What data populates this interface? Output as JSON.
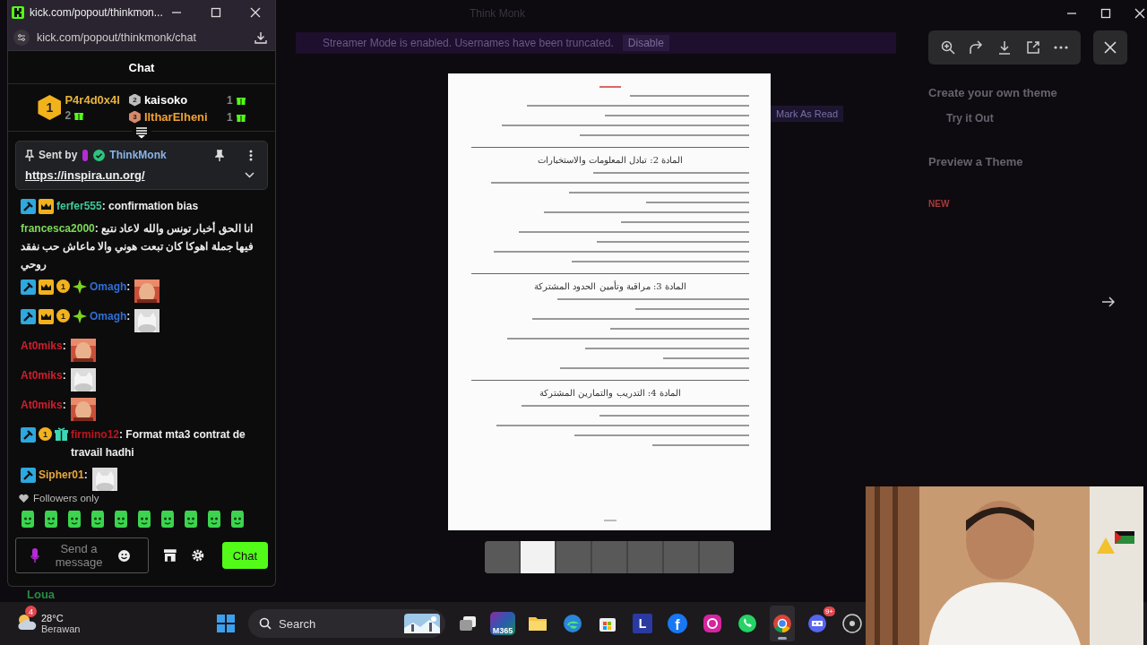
{
  "background": {
    "title": "Think Monk",
    "banner": "Streamer Mode is enabled. Usernames have been truncated.",
    "banner_button": "Disable",
    "mark_read": "Mark As Read",
    "theme_title": "Create your own theme",
    "theme_button": "Try it Out",
    "preview_title": "Preview a Theme",
    "new_badge": "NEW",
    "footer_name": "Loua"
  },
  "window": {
    "title": "kick.com/popout/thinkmon...",
    "url": "kick.com/popout/thinkmonk/chat"
  },
  "chat": {
    "heading": "Chat",
    "leaderboard": [
      {
        "rank": "1",
        "name": "P4r4d0x4l",
        "count": "2",
        "color": "#e6b43c"
      },
      {
        "rank": "2",
        "name": "kaisoko",
        "count": "1",
        "color": "#ffffff"
      },
      {
        "rank": "3",
        "name": "IltharElheni",
        "count": "1",
        "color": "#f0a232"
      }
    ],
    "pinned": {
      "label": "Sent by",
      "user": "ThinkMonk",
      "link": "https://inspira.un.org/"
    },
    "messages": [
      {
        "user": "ferfer555",
        "color": "#3fc99a",
        "badges": [
          {
            "kind": "moderator"
          },
          {
            "kind": "vip"
          }
        ],
        "separator": ":",
        "kind": "text",
        "text": "confirmation bias"
      },
      {
        "user": "francesca2000",
        "color": "#7ed957",
        "separator": ":",
        "kind": "text",
        "text": "انا الحق أخبار تونس والله لاعاد نتبع فيها جملة اهوكا كان تبعت هوني والا ماعاش حب نفقد روحي"
      },
      {
        "user": "Omagh",
        "color": "#2f6fd6",
        "badges": [
          {
            "kind": "moderator"
          },
          {
            "kind": "vip"
          },
          {
            "kind": "sub",
            "label": "1"
          },
          {
            "kind": "gem"
          }
        ],
        "separator": ":",
        "kind": "emote"
      },
      {
        "user": "Omagh",
        "color": "#2f6fd6",
        "badges": [
          {
            "kind": "moderator"
          },
          {
            "kind": "vip"
          },
          {
            "kind": "sub",
            "label": "1"
          },
          {
            "kind": "gem"
          }
        ],
        "separator": ":",
        "kind": "emote"
      },
      {
        "user": "At0miks",
        "color": "#d21e2d",
        "separator": ":",
        "kind": "emote"
      },
      {
        "user": "At0miks",
        "color": "#d21e2d",
        "separator": ":",
        "kind": "emote"
      },
      {
        "user": "At0miks",
        "color": "#d21e2d",
        "separator": ":",
        "kind": "emote"
      },
      {
        "user": "firmino12",
        "color": "#c0141e",
        "badges": [
          {
            "kind": "moderator"
          },
          {
            "kind": "sub",
            "label": "1"
          },
          {
            "kind": "gift"
          }
        ],
        "separator": ":",
        "kind": "text",
        "text": "Format mta3 contrat de travail hadhi"
      },
      {
        "user": "Sipher01",
        "color": "#e8a83c",
        "badges": [
          {
            "kind": "moderator"
          }
        ],
        "separator": ":",
        "kind": "emote"
      }
    ],
    "mode": "Followers only",
    "input": {
      "placeholder": "Send a message"
    },
    "send_button": "Chat"
  },
  "viewer": {
    "headings": [
      "المادة 2: تبادل المعلومات والاستخبارات",
      "المادة 3: مراقبة وتأمين الحدود المشتركة",
      "المادة 4: التدريب والتمارين المشتركة"
    ],
    "thumbnails": [
      {
        "selected": false
      },
      {
        "selected": true
      },
      {
        "selected": false
      },
      {
        "selected": false
      },
      {
        "selected": false
      },
      {
        "selected": false
      },
      {
        "selected": false
      }
    ]
  },
  "taskbar": {
    "weather": {
      "temp": "28°C",
      "condition": "Berawan",
      "badge": "4"
    },
    "search": "Search",
    "apps": [
      {
        "kind": "windows",
        "active": false
      },
      {
        "kind": "taskview",
        "active": false
      },
      {
        "kind": "m365",
        "label": "M365",
        "active": false
      },
      {
        "kind": "folder",
        "active": false
      },
      {
        "kind": "browser",
        "active": false
      },
      {
        "kind": "store",
        "active": false
      },
      {
        "kind": "letter",
        "label": "L",
        "active": false
      },
      {
        "kind": "social",
        "label": "f",
        "active": false
      },
      {
        "kind": "camera",
        "active": false
      },
      {
        "kind": "phone",
        "active": false
      },
      {
        "kind": "chrome",
        "active": true
      },
      {
        "kind": "gamepad",
        "badge": "9+",
        "active": false
      },
      {
        "kind": "recorder",
        "active": false
      }
    ]
  }
}
